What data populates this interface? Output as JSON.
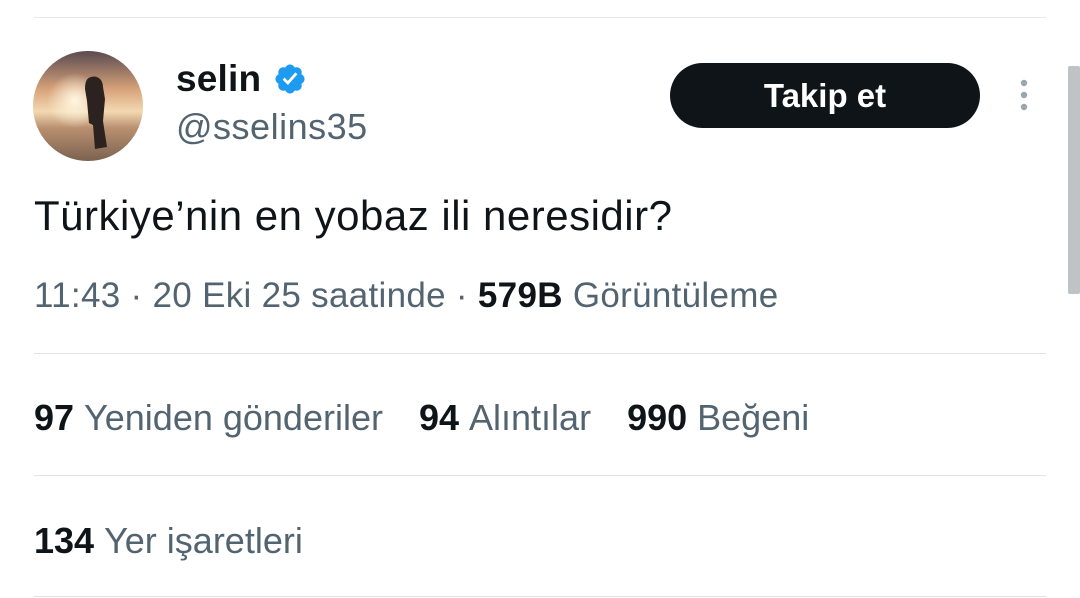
{
  "user": {
    "name": "selin",
    "handle": "@sselins35",
    "verified": true
  },
  "follow_button": {
    "label": "Takip et"
  },
  "tweet": {
    "text": "Türkiye’nin en yobaz ili neresidir?",
    "time": "11:43",
    "date": "20 Eki 25 saatinde",
    "views_count": "579B",
    "views_label": "Görüntüleme"
  },
  "stats": {
    "reposts": {
      "count": "97",
      "label": "Yeniden gönderiler"
    },
    "quotes": {
      "count": "94",
      "label": "Alıntılar"
    },
    "likes": {
      "count": "990",
      "label": "Beğeni"
    },
    "bookmarks": {
      "count": "134",
      "label": "Yer işaretleri"
    }
  },
  "colors": {
    "text": "#0f1419",
    "secondary": "#536471",
    "verified": "#1d9bf0",
    "button_bg": "#0f1419"
  },
  "icons": [
    "verified-badge-icon",
    "more-options-icon"
  ]
}
